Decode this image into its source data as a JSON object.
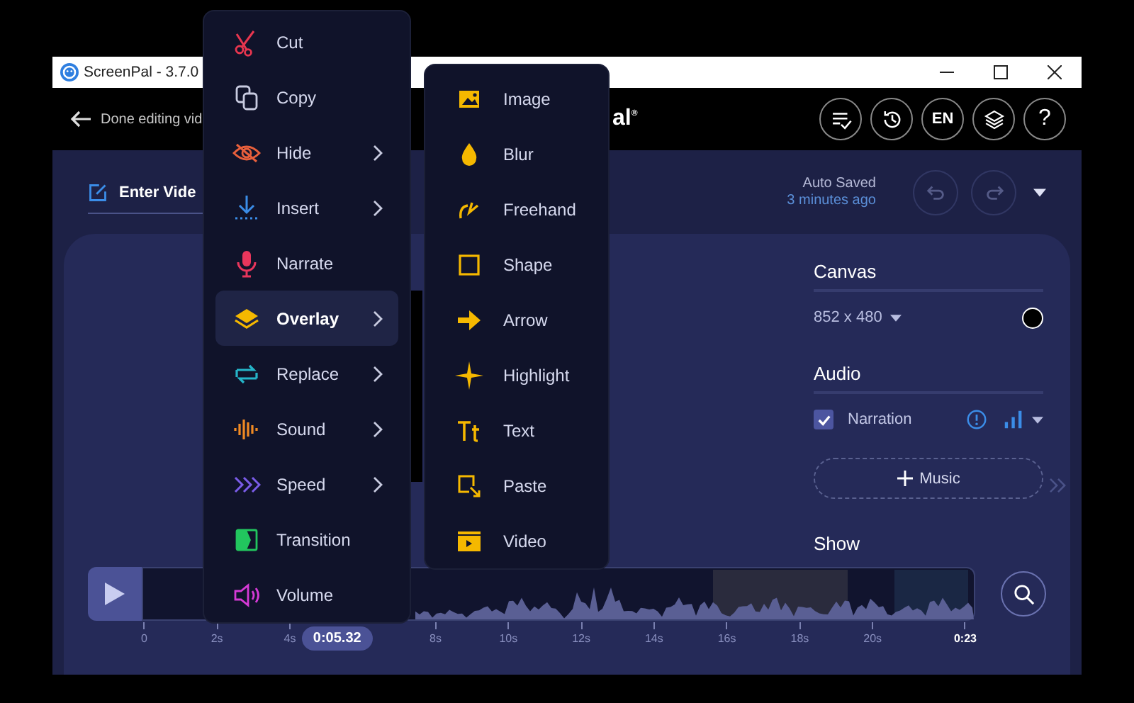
{
  "window": {
    "title": "ScreenPal - 3.7.0"
  },
  "header": {
    "back_label": "Done editing vid",
    "logo": "al$^{®}$",
    "buttons": [
      {
        "kind": "checklist"
      },
      {
        "kind": "history"
      },
      {
        "kind": "language",
        "label": "EN"
      },
      {
        "kind": "layers"
      },
      {
        "kind": "help",
        "label": "?"
      }
    ]
  },
  "project": {
    "title": "Enter Vide"
  },
  "autosave": {
    "label": "Auto Saved",
    "time": "3 minutes ago"
  },
  "history": {
    "undo": {
      "disabled": true
    },
    "redo": {
      "disabled": true
    }
  },
  "context_menu": {
    "items": [
      {
        "label": "Cut",
        "has_submenu": false,
        "selected": false
      },
      {
        "label": "Copy",
        "has_submenu": false,
        "selected": false
      },
      {
        "label": "Hide",
        "has_submenu": true,
        "selected": false
      },
      {
        "label": "Insert",
        "has_submenu": true,
        "selected": false
      },
      {
        "label": "Narrate",
        "has_submenu": false,
        "selected": false
      },
      {
        "label": "Overlay",
        "has_submenu": true,
        "selected": true
      },
      {
        "label": "Replace",
        "has_submenu": true,
        "selected": false
      },
      {
        "label": "Sound",
        "has_submenu": true,
        "selected": false
      },
      {
        "label": "Speed",
        "has_submenu": true,
        "selected": false
      },
      {
        "label": "Transition",
        "has_submenu": false,
        "selected": false
      },
      {
        "label": "Volume",
        "has_submenu": false,
        "selected": false
      }
    ]
  },
  "overlay_menu": {
    "items": [
      {
        "label": "Image"
      },
      {
        "label": "Blur"
      },
      {
        "label": "Freehand"
      },
      {
        "label": "Shape"
      },
      {
        "label": "Arrow"
      },
      {
        "label": "Highlight"
      },
      {
        "label": "Text"
      },
      {
        "label": "Paste"
      },
      {
        "label": "Video"
      }
    ]
  },
  "canvas": {
    "heading": "Canvas",
    "size": "852 x 480",
    "color": "#000000"
  },
  "audio": {
    "heading": "Audio",
    "tracks": [
      {
        "label": "Narration",
        "checked": true
      }
    ],
    "music_label": "Music"
  },
  "show": {
    "heading": "Show"
  },
  "timeline": {
    "scale": [
      {
        "kind": "tick",
        "label": "0"
      },
      {
        "kind": "tick",
        "label": "2s"
      },
      {
        "kind": "tick",
        "label": "4s"
      },
      {
        "kind": "playhead",
        "label": "0:05.32"
      },
      {
        "kind": "tick",
        "label": "8s"
      },
      {
        "kind": "tick",
        "label": "10s"
      },
      {
        "kind": "tick",
        "label": "12s"
      },
      {
        "kind": "tick",
        "label": "14s"
      },
      {
        "kind": "tick",
        "label": "16s"
      },
      {
        "kind": "tick",
        "label": "18s"
      },
      {
        "kind": "tick",
        "label": "20s"
      },
      {
        "kind": "end",
        "label": "0:23"
      }
    ]
  }
}
